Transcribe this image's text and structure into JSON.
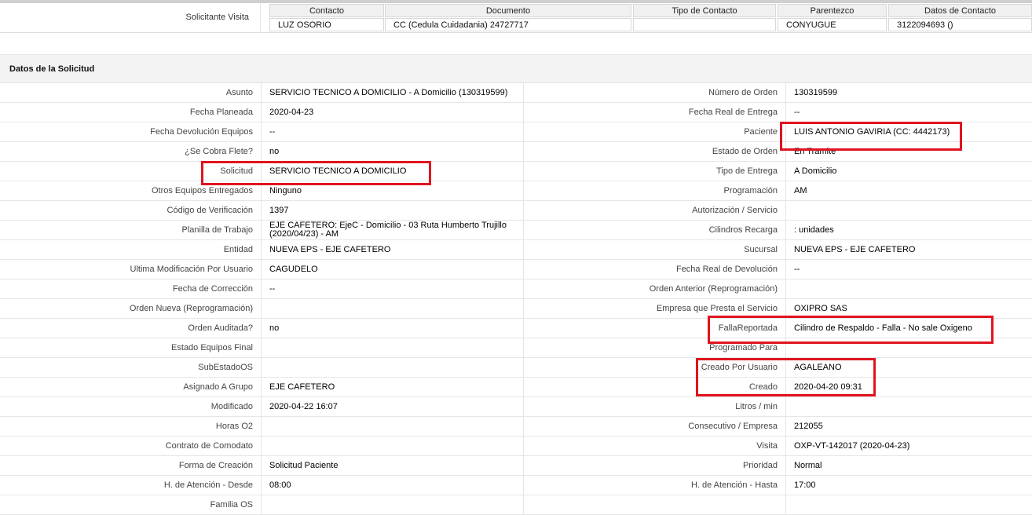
{
  "visit": {
    "label": "Solicitante Visita",
    "headers": [
      "Contacto",
      "Documento",
      "Tipo de Contacto",
      "Parentezco",
      "Datos de Contacto"
    ],
    "values": [
      "LUZ OSORIO",
      "CC (Cedula Cuidadania) 24727717",
      "",
      "CONYUGUE",
      "3122094693 ()"
    ]
  },
  "section_title": "Datos de la Solicitud",
  "rows": [
    {
      "l_label": "Asunto",
      "l_value": "SERVICIO TECNICO A DOMICILIO - A Domicilio (130319599)",
      "r_label": "Número de Orden",
      "r_value": "130319599"
    },
    {
      "l_label": "Fecha Planeada",
      "l_value": "2020-04-23",
      "r_label": "Fecha Real de Entrega",
      "r_value": "--"
    },
    {
      "l_label": "Fecha Devolución Equipos",
      "l_value": "--",
      "r_label": "Paciente",
      "r_value": "LUIS ANTONIO GAVIRIA (CC: 4442173)"
    },
    {
      "l_label": "¿Se Cobra Flete?",
      "l_value": "no",
      "r_label": "Estado de Orden",
      "r_value": "En Tramite"
    },
    {
      "l_label": "Solicitud",
      "l_value": "SERVICIO TECNICO A DOMICILIO",
      "r_label": "Tipo de Entrega",
      "r_value": "A Domicilio"
    },
    {
      "l_label": "Otros Equipos Entregados",
      "l_value": "Ninguno",
      "r_label": "Programación",
      "r_value": "AM"
    },
    {
      "l_label": "Código de Verificación",
      "l_value": "1397",
      "r_label": "Autorización / Servicio",
      "r_value": ""
    },
    {
      "l_label": "Planilla de Trabajo",
      "l_value": "EJE CAFETERO: EjeC - Domicilio - 03 Ruta Humberto Trujillo (2020/04/23) - AM",
      "r_label": "Cilindros Recarga",
      "r_value": ": unidades"
    },
    {
      "l_label": "Entidad",
      "l_value": "NUEVA EPS - EJE CAFETERO",
      "r_label": "Sucursal",
      "r_value": "NUEVA EPS - EJE CAFETERO"
    },
    {
      "l_label": "Ultima Modificación Por Usuario",
      "l_value": "CAGUDELO",
      "r_label": "Fecha Real de Devolución",
      "r_value": "--"
    },
    {
      "l_label": "Fecha de Corrección",
      "l_value": "--",
      "r_label": "Orden Anterior (Reprogramación)",
      "r_value": ""
    },
    {
      "l_label": "Orden Nueva (Reprogramación)",
      "l_value": "",
      "r_label": "Empresa que Presta el Servicio",
      "r_value": "OXIPRO SAS"
    },
    {
      "l_label": "Orden Auditada?",
      "l_value": "no",
      "r_label": "FallaReportada",
      "r_value": "Cilindro de Respaldo - Falla - No sale Oxigeno"
    },
    {
      "l_label": "Estado Equipos Final",
      "l_value": "",
      "r_label": "Programado Para",
      "r_value": ""
    },
    {
      "l_label": "SubEstadoOS",
      "l_value": "",
      "r_label": "Creado Por Usuario",
      "r_value": "AGALEANO"
    },
    {
      "l_label": "Asignado A Grupo",
      "l_value": "EJE CAFETERO",
      "r_label": "Creado",
      "r_value": "2020-04-20 09:31"
    },
    {
      "l_label": "Modificado",
      "l_value": "2020-04-22 16:07",
      "r_label": "Litros / min",
      "r_value": ""
    },
    {
      "l_label": "Horas O2",
      "l_value": "",
      "r_label": "Consecutivo / Empresa",
      "r_value": "212055"
    },
    {
      "l_label": "Contrato de Comodato",
      "l_value": "",
      "r_label": "Visita",
      "r_value": "OXP-VT-142017 (2020-04-23)"
    },
    {
      "l_label": "Forma de Creación",
      "l_value": "Solicitud Paciente",
      "r_label": "Prioridad",
      "r_value": "Normal"
    },
    {
      "l_label": "H. de Atención - Desde",
      "l_value": "08:00",
      "r_label": "H. de Atención - Hasta",
      "r_value": "17:00"
    },
    {
      "l_label": "Familia OS",
      "l_value": "",
      "r_label": "",
      "r_value": ""
    }
  ],
  "colors": {
    "annotation": "#e0141e",
    "header_bg": "#f3f3f3"
  }
}
